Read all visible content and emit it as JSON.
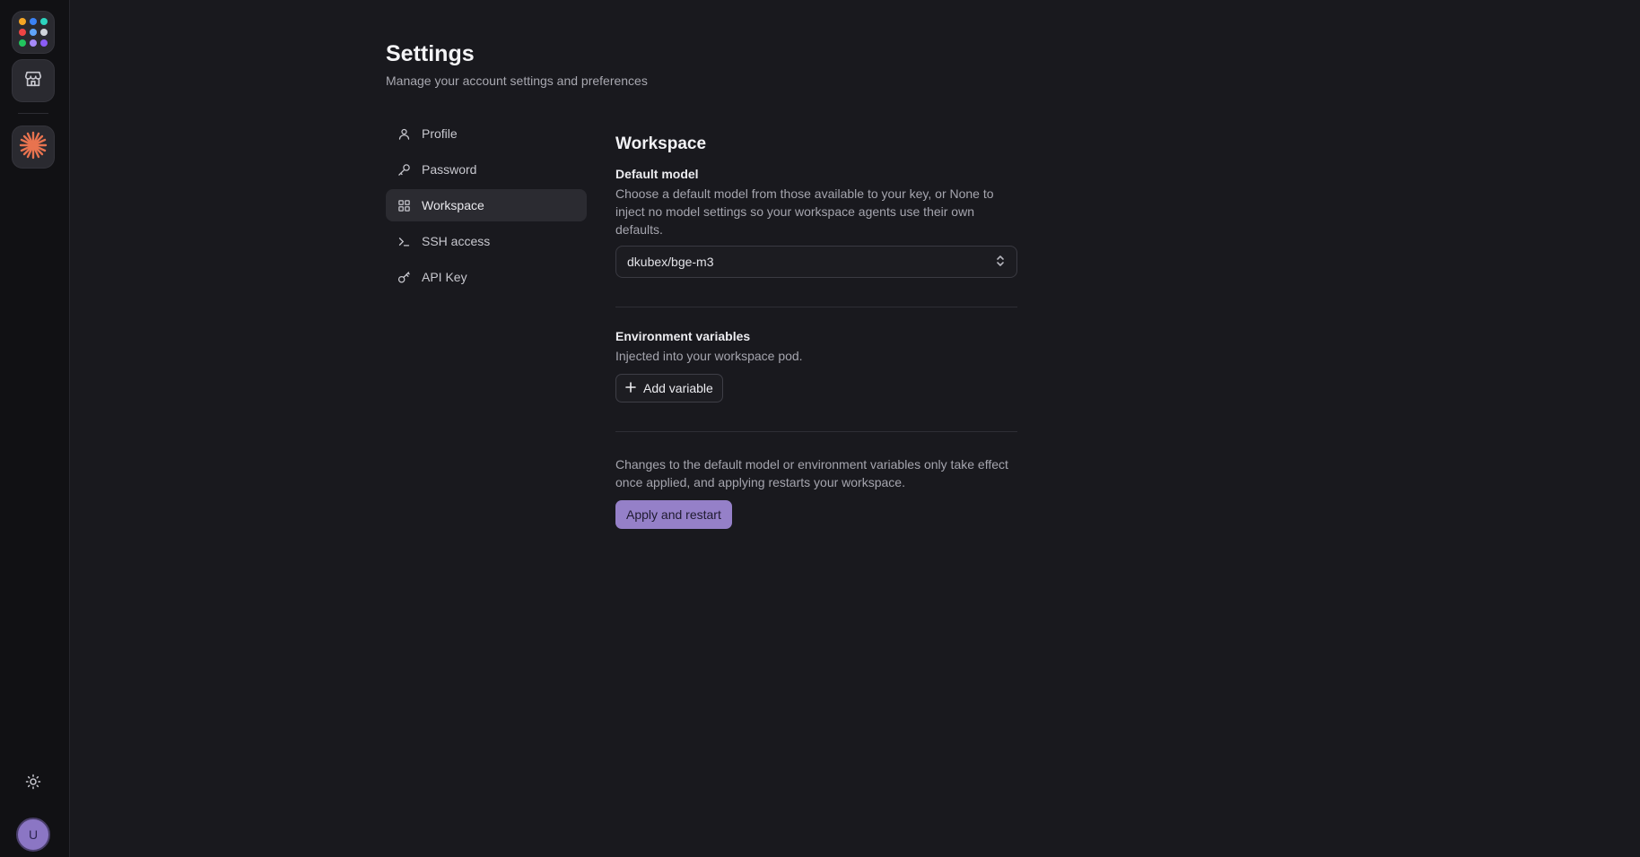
{
  "rail": {
    "apps_icon": "apps-grid-icon",
    "store_icon": "storefront-icon",
    "app_icon": "starburst-logo-icon",
    "theme_icon": "sun-icon",
    "avatar_initial": "U",
    "dot_colors": [
      "#f5a524",
      "#3b82f6",
      "#22c55e",
      "#ef4444",
      "#8b5cf6",
      "#d1d5db",
      "#10b981",
      "#a78bfa",
      "#f472b6"
    ]
  },
  "header": {
    "title": "Settings",
    "subtitle": "Manage your account settings and preferences"
  },
  "nav": {
    "items": [
      {
        "label": "Profile",
        "icon": "user-icon"
      },
      {
        "label": "Password",
        "icon": "key-icon"
      },
      {
        "label": "Workspace",
        "icon": "grid-icon",
        "active": true
      },
      {
        "label": "SSH access",
        "icon": "terminal-icon"
      },
      {
        "label": "API Key",
        "icon": "api-key-icon"
      }
    ]
  },
  "workspace": {
    "title": "Workspace",
    "default_model": {
      "label": "Default model",
      "description": "Choose a default model from those available to your key, or None to inject no model settings so your workspace agents use their own defaults.",
      "value": "dkubex/bge-m3"
    },
    "env_vars": {
      "label": "Environment variables",
      "description": "Injected into your workspace pod.",
      "add_button": "Add variable"
    },
    "apply": {
      "note": "Changes to the default model or environment variables only take effect once applied, and applying restarts your workspace.",
      "button": "Apply and restart"
    }
  },
  "colors": {
    "accent": "#9580c8",
    "background": "#19191e",
    "rail": "#111114",
    "logo": "#e8734f"
  }
}
